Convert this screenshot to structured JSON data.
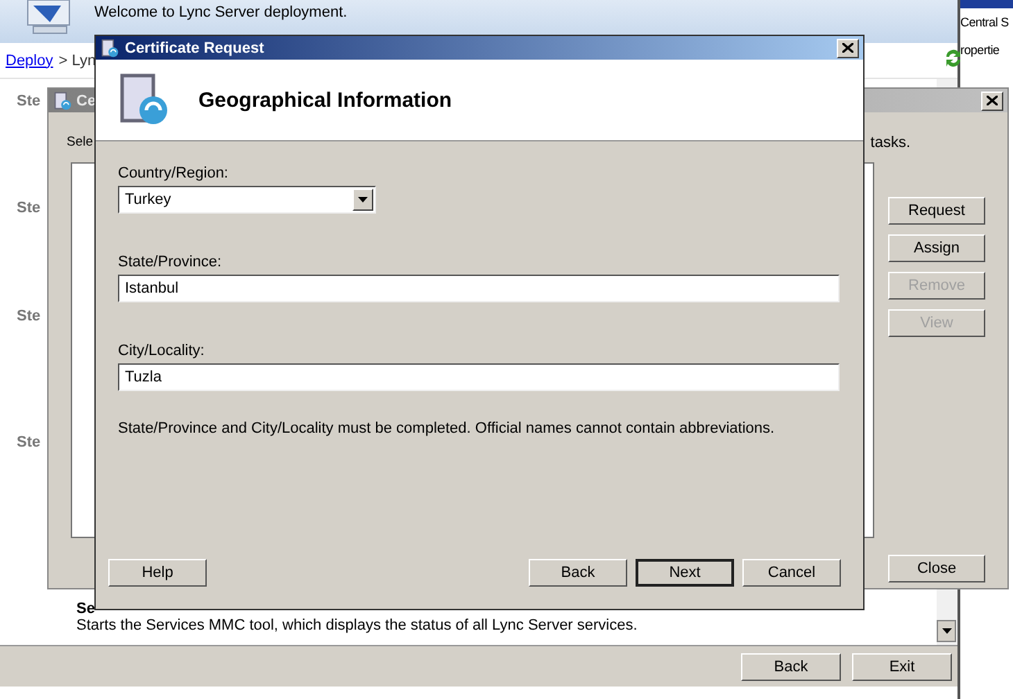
{
  "deployment_window": {
    "banner_text": "Welcome to Lync Server deployment.",
    "breadcrumb": [
      {
        "kind": "link",
        "text": "Deploy"
      },
      {
        "kind": "text",
        "text": "> Lyn"
      }
    ],
    "step_labels": [
      "Ste",
      "Ste",
      "Ste",
      "Ste"
    ],
    "section_title": "Se",
    "section_description": "Starts the Services MMC tool, which displays the status of all Lync Server services.",
    "buttons": [
      {
        "label": "Back"
      },
      {
        "label": "Exit"
      }
    ]
  },
  "side_window": {
    "lines": [
      "Central S",
      "ropertie"
    ]
  },
  "certificate_window": {
    "title": "Ce",
    "intro": "Sele",
    "intro_end": "tasks.",
    "buttons": [
      {
        "label": "Request",
        "disabled": false
      },
      {
        "label": "Assign",
        "disabled": false
      },
      {
        "label": "Remove",
        "disabled": true
      },
      {
        "label": "View",
        "disabled": true
      }
    ],
    "close_button": "Close"
  },
  "dialog": {
    "title": "Certificate Request",
    "heading": "Geographical Information",
    "fields": [
      {
        "kind": "dropdown",
        "label": "Country/Region:",
        "value": "Turkey"
      },
      {
        "kind": "text",
        "label": "State/Province:",
        "value": "Istanbul"
      },
      {
        "kind": "text",
        "label": "City/Locality:",
        "value": "Tuzla"
      }
    ],
    "note": "State/Province and City/Locality must be completed. Official names cannot contain abbreviations.",
    "help_button": "Help",
    "buttons": [
      {
        "label": "Back",
        "default": false
      },
      {
        "label": "Next",
        "default": true
      },
      {
        "label": "Cancel",
        "default": false
      }
    ]
  }
}
